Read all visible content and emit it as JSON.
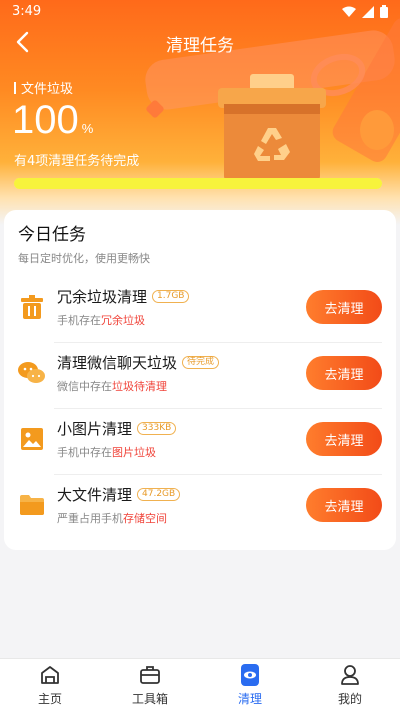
{
  "status_bar": {
    "time": "3:49"
  },
  "header": {
    "title": "清理任务",
    "back_icon": "chevron-left-icon"
  },
  "hero": {
    "label": "文件垃圾",
    "percent": "100",
    "percent_sign": "%",
    "subtitle": "有4项清理任务待完成",
    "progress_fraction": 1.0,
    "illustration": "recycle-bin-icon"
  },
  "tasks_card": {
    "title": "今日任务",
    "subtitle": "每日定时优化，使用更畅快",
    "tasks": [
      {
        "name": "冗余垃圾清理",
        "badge": "1.7GB",
        "desc_prefix": "手机存在",
        "desc_highlight": "冗余垃圾",
        "button": "去清理",
        "icon": "trash-icon"
      },
      {
        "name": "清理微信聊天垃圾",
        "badge": "待完成",
        "desc_prefix": "微信中存在",
        "desc_highlight": "垃圾待清理",
        "button": "去清理",
        "icon": "wechat-icon"
      },
      {
        "name": "小图片清理",
        "badge": "333KB",
        "desc_prefix": "手机中存在",
        "desc_highlight": "图片垃圾",
        "button": "去清理",
        "icon": "image-icon"
      },
      {
        "name": "大文件清理",
        "badge": "47.2GB",
        "desc_prefix": "严重占用手机",
        "desc_highlight": "存储空间",
        "button": "去清理",
        "icon": "folder-icon"
      }
    ]
  },
  "tabbar": {
    "items": [
      {
        "label": "主页",
        "icon": "home-icon",
        "active": false
      },
      {
        "label": "工具箱",
        "icon": "toolbox-icon",
        "active": false
      },
      {
        "label": "清理",
        "icon": "clean-icon",
        "active": true
      },
      {
        "label": "我的",
        "icon": "profile-icon",
        "active": false
      }
    ]
  },
  "colors": {
    "accent": "#ff6a1a",
    "button": "#f24b18",
    "highlight": "#f0443a",
    "tab_active": "#2a6cf0",
    "progress": "#f7f33c"
  }
}
